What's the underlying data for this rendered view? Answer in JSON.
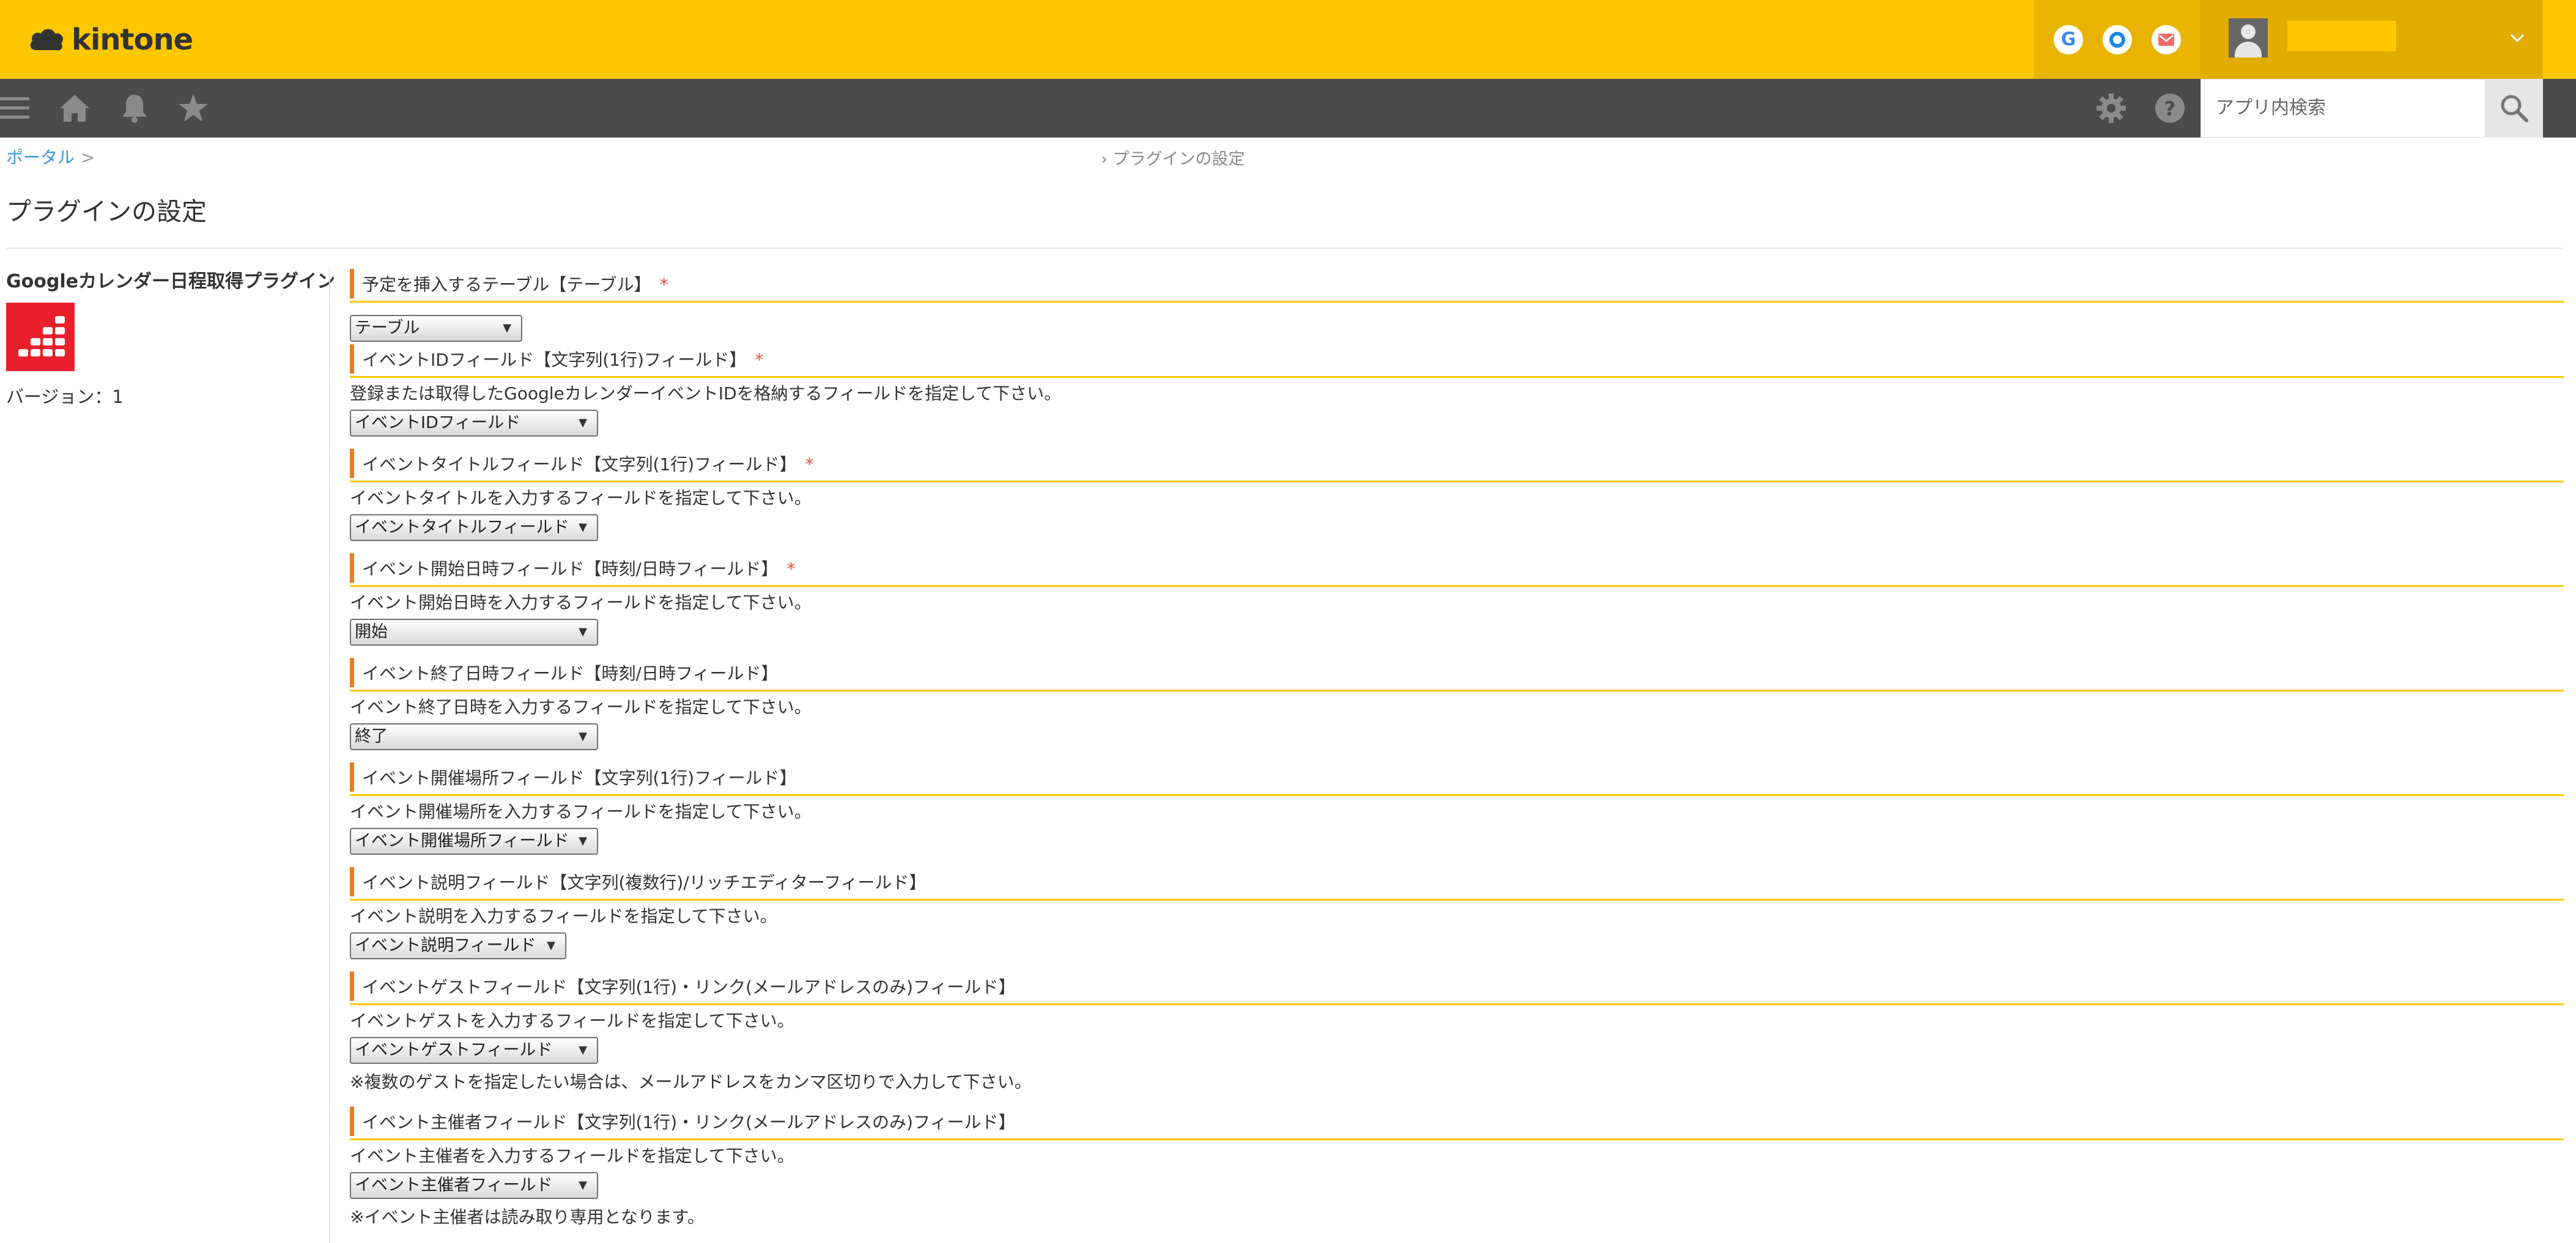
{
  "header": {
    "logo_text": "kintone",
    "icons": [
      "google-icon",
      "garoon-icon",
      "mail-icon"
    ],
    "google_letter": "G",
    "accent_color": "#fec800"
  },
  "navbar": {
    "search_placeholder": "アプリ内検索",
    "icons": [
      "menu-icon",
      "home-icon",
      "bell-icon",
      "star-icon",
      "gear-icon",
      "help-icon",
      "search-icon"
    ]
  },
  "breadcrumb": {
    "home": "ポータル",
    "separator": ">",
    "current": "› プラグインの設定"
  },
  "page_title": "プラグインの設定",
  "plugin": {
    "name": "Googleカレンダー日程取得プラグイン",
    "version": "バージョン：1"
  },
  "sections": [
    {
      "label": "予定を挿入するテーブル【テーブル】",
      "required": "*",
      "select_value": "テーブル"
    },
    {
      "label": "イベントIDフィールド【文字列(1行)フィールド】",
      "required": "*",
      "description": "登録または取得したGoogleカレンダーイベントIDを格納するフィールドを指定して下さい。",
      "select_value": "イベントIDフィールド"
    },
    {
      "label": "イベントタイトルフィールド【文字列(1行)フィールド】",
      "required": "*",
      "description": "イベントタイトルを入力するフィールドを指定して下さい。",
      "select_value": "イベントタイトルフィールド"
    },
    {
      "label": "イベント開始日時フィールド【時刻/日時フィールド】",
      "required": "*",
      "description": "イベント開始日時を入力するフィールドを指定して下さい。",
      "select_value": "開始"
    },
    {
      "label": "イベント終了日時フィールド【時刻/日時フィールド】",
      "description": "イベント終了日時を入力するフィールドを指定して下さい。",
      "select_value": "終了"
    },
    {
      "label": "イベント開催場所フィールド【文字列(1行)フィールド】",
      "description": "イベント開催場所を入力するフィールドを指定して下さい。",
      "select_value": "イベント開催場所フィールド"
    },
    {
      "label": "イベント説明フィールド【文字列(複数行)/リッチエディターフィールド】",
      "description": "イベント説明を入力するフィールドを指定して下さい。",
      "select_value": "イベント説明フィールド"
    },
    {
      "label": "イベントゲストフィールド【文字列(1行)・リンク(メールアドレスのみ)フィールド】",
      "description": "イベントゲストを入力するフィールドを指定して下さい。",
      "select_value": "イベントゲストフィールド",
      "note": "※複数のゲストを指定したい場合は、メールアドレスをカンマ区切りで入力して下さい。"
    },
    {
      "label": "イベント主催者フィールド【文字列(1行)・リンク(メールアドレスのみ)フィールド】",
      "description": "イベント主催者を入力するフィールドを指定して下さい。",
      "select_value": "イベント主催者フィールド",
      "note": "※イベント主催者は読み取り専用となります。"
    }
  ],
  "dropdown_arrow": "▼"
}
